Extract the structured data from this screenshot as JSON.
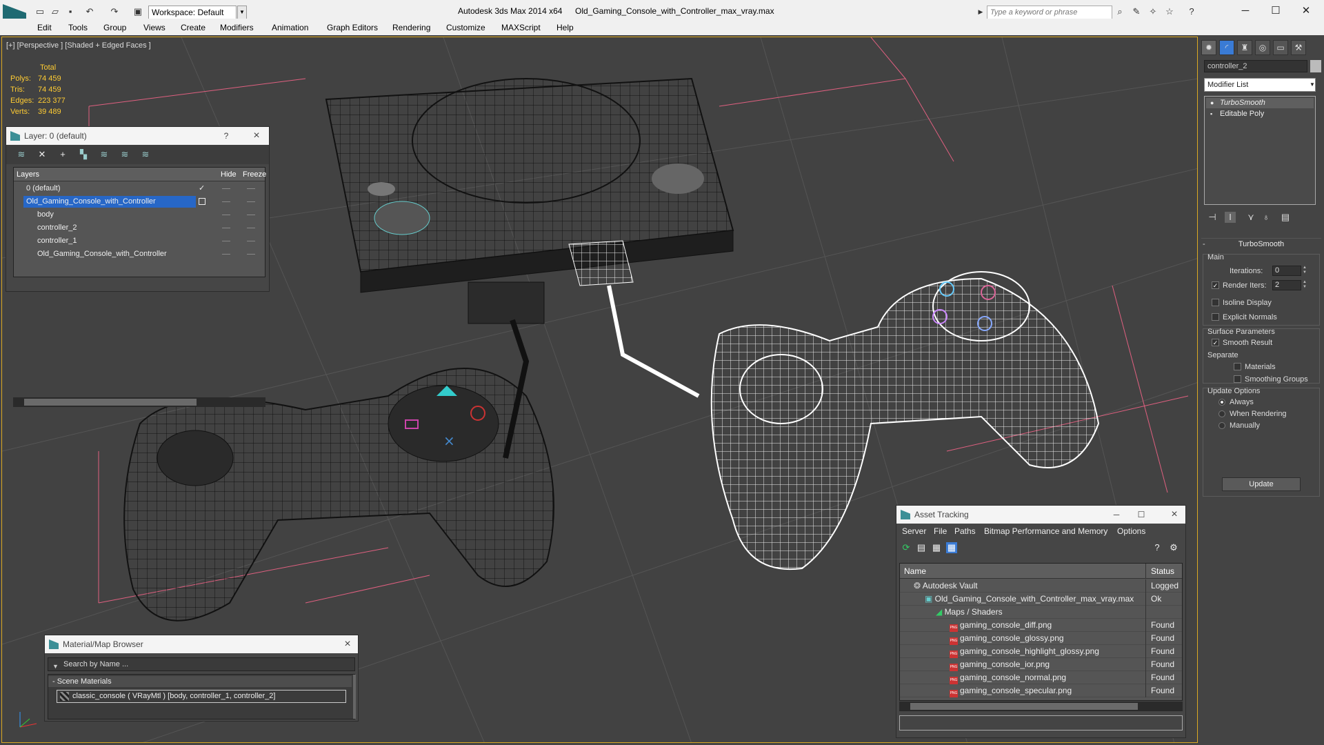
{
  "titlebar": {
    "workspace": "Workspace: Default",
    "app_title": "Autodesk 3ds Max  2014 x64",
    "file_title": "Old_Gaming_Console_with_Controller_max_vray.max",
    "search_placeholder": "Type a keyword or phrase"
  },
  "menu": [
    "Edit",
    "Tools",
    "Group",
    "Views",
    "Create",
    "Modifiers",
    "Animation",
    "Graph Editors",
    "Rendering",
    "Customize",
    "MAXScript",
    "Help"
  ],
  "viewport": {
    "label": "[+] [Perspective ] [Shaded + Edged Faces ]",
    "stats": {
      "header": "Total",
      "polys_label": "Polys:",
      "polys": "74 459",
      "tris_label": "Tris:",
      "tris": "74 459",
      "edges_label": "Edges:",
      "edges": "223 377",
      "verts_label": "Verts:",
      "verts": "39 489"
    }
  },
  "layer_panel": {
    "title": "Layer: 0 (default)",
    "help": "?",
    "col_layers": "Layers",
    "col_hide": "Hide",
    "col_freeze": "Freeze",
    "rows": [
      "0 (default)",
      "Old_Gaming_Console_with_Controller",
      "body",
      "controller_2",
      "controller_1",
      "Old_Gaming_Console_with_Controller"
    ]
  },
  "command_panel": {
    "object_name": "controller_2",
    "modifier_list": "Modifier List",
    "stack": [
      "TurboSmooth",
      "Editable Poly"
    ],
    "turbosmooth": {
      "title": "TurboSmooth",
      "main": "Main",
      "iterations_label": "Iterations:",
      "iterations": "0",
      "render_iters_label": "Render Iters:",
      "render_iters": "2",
      "isoline": "Isoline Display",
      "explicit_normals": "Explicit Normals",
      "surface_params": "Surface Parameters",
      "smooth_result": "Smooth Result",
      "separate": "Separate",
      "materials": "Materials",
      "smoothing_groups": "Smoothing Groups",
      "update_options": "Update Options",
      "always": "Always",
      "when_rendering": "When Rendering",
      "manually": "Manually",
      "update": "Update"
    }
  },
  "asset_tracking": {
    "title": "Asset Tracking",
    "menu": [
      "Server",
      "File",
      "Paths",
      "Bitmap Performance and Memory",
      "Options"
    ],
    "col_name": "Name",
    "col_status": "Status",
    "rows": [
      {
        "name": "Autodesk Vault",
        "status": "Logged"
      },
      {
        "name": "Old_Gaming_Console_with_Controller_max_vray.max",
        "status": "Ok"
      },
      {
        "name": "Maps / Shaders",
        "status": ""
      },
      {
        "name": "gaming_console_diff.png",
        "status": "Found"
      },
      {
        "name": "gaming_console_glossy.png",
        "status": "Found"
      },
      {
        "name": "gaming_console_highlight_glossy.png",
        "status": "Found"
      },
      {
        "name": "gaming_console_ior.png",
        "status": "Found"
      },
      {
        "name": "gaming_console_normal.png",
        "status": "Found"
      },
      {
        "name": "gaming_console_specular.png",
        "status": "Found"
      }
    ]
  },
  "material_browser": {
    "title": "Material/Map Browser",
    "search": "Search by Name ...",
    "group": "- Scene Materials",
    "item": "classic_console ( VRayMtl ) [body, controller_1, controller_2]"
  }
}
